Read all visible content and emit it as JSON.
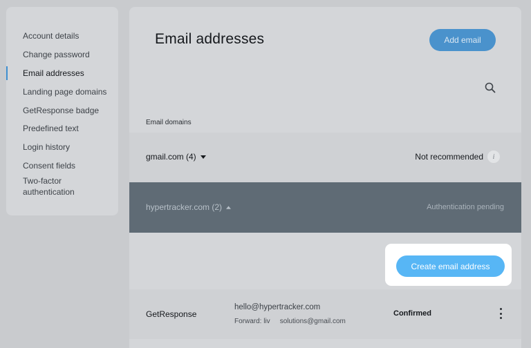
{
  "sidebar": {
    "items": [
      {
        "label": "Account details"
      },
      {
        "label": "Change password"
      },
      {
        "label": "Email addresses"
      },
      {
        "label": "Landing page domains"
      },
      {
        "label": "GetResponse badge"
      },
      {
        "label": "Predefined text"
      },
      {
        "label": "Login history"
      },
      {
        "label": "Consent fields"
      },
      {
        "label": "Two-factor authentication"
      }
    ],
    "active_index": 2
  },
  "main": {
    "title": "Email addresses",
    "add_button": "Add email",
    "search_icon": "search-icon",
    "column_header": "Email domains",
    "domains": [
      {
        "name": "gmail.com (4)",
        "status": "Not recommended",
        "expanded": false
      },
      {
        "name": "hypertracker.com (2)",
        "status": "Authentication pending",
        "expanded": true
      }
    ],
    "create_button": "Create email address",
    "addresses": [
      {
        "name": "GetResponse",
        "email": "hello@hypertracker.com",
        "forward_prefix": "Forward: liv",
        "forward_suffix": "solutions@gmail.com",
        "status": "Confirmed"
      }
    ]
  },
  "colors": {
    "accent": "#4a92cc",
    "create_button": "#57b6f5",
    "expanded_row": "#5f6b75"
  }
}
